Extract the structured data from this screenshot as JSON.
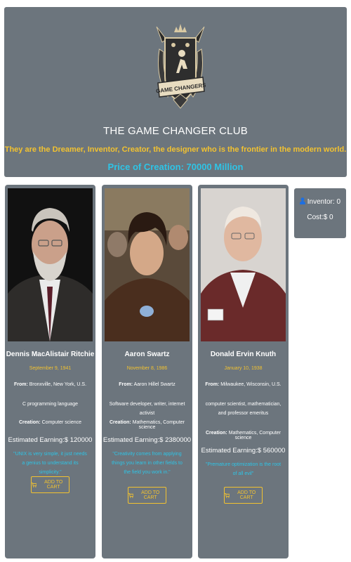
{
  "header": {
    "logo_text": "GAME CHANGERS",
    "title": "THE GAME CHANGER CLUB",
    "subtitle": "They are the Dreamer, Inventor, Creator, the designer who is the frontier in the modern world.",
    "price": "Price of Creation: 70000 Million"
  },
  "summary": {
    "inventor_label": "Inventor: 0",
    "cost_label": "Cost:$ 0",
    "icon": "user-icon"
  },
  "colors": {
    "panel": "#6c757d",
    "accent_yellow": "#f2c230",
    "accent_cyan": "#2ec4e6"
  },
  "cards": [
    {
      "name": "Dennis MacAlistair Ritchie",
      "dob": "September 9, 1941",
      "from_label": "From:",
      "from": "Bronxville, New York, U.S.",
      "known_for": "C programming language",
      "creation_label": "Creation:",
      "creation": "Computer science",
      "earning": "Estimated Earning:$ 120000",
      "quote": "\"UNIX is very simple, it just needs a genius to understand its simplicity.\"",
      "button": "ADD TO CART"
    },
    {
      "name": "Aaron Swartz",
      "dob": "November 8, 1986",
      "from_label": "From:",
      "from": "Aaron Hillel Swartz",
      "known_for": "Software developer, writer, internet activist",
      "creation_label": "Creation:",
      "creation": "Mathematics, Computer science",
      "earning": "Estimated Earning:$ 2380000",
      "quote": "\"Creativity comes from applying things you learn in other fields to the field you work in.\"",
      "button": "ADD TO CART"
    },
    {
      "name": "Donald Ervin Knuth",
      "dob": "January 10, 1938",
      "from_label": "From:",
      "from": "Milwaukee, Wisconsin, U.S.",
      "known_for": "computer scientist, mathematician, and professor emeritus",
      "creation_label": "Creation:",
      "creation": "Mathematics, Computer science",
      "earning": "Estimated Earning:$ 560000",
      "quote": "\"Premature optimization is the root of all evil\"",
      "button": "ADD TO CART"
    }
  ]
}
